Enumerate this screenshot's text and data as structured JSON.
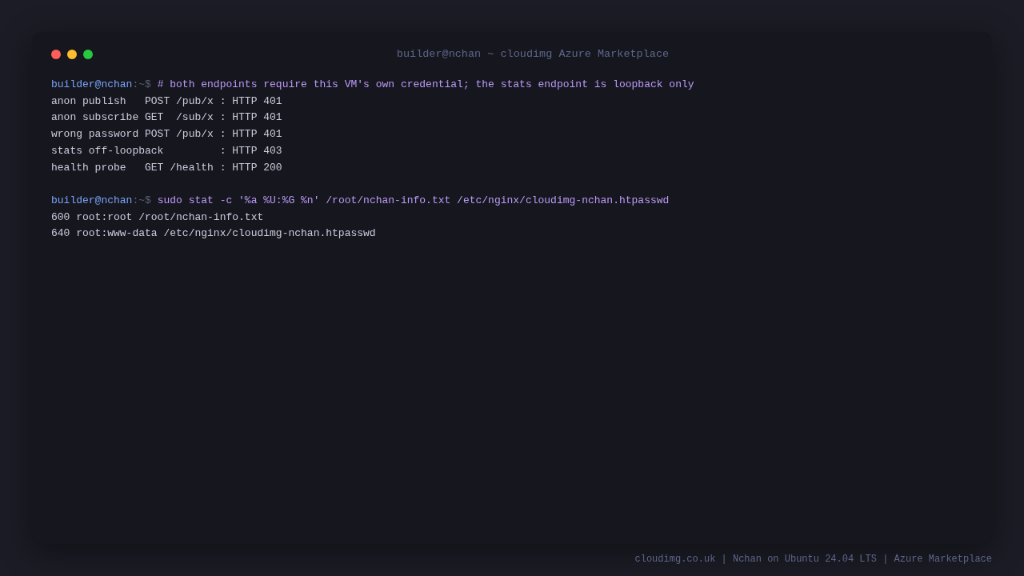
{
  "window": {
    "title": "builder@nchan ~ cloudimg Azure Marketplace"
  },
  "blocks": [
    {
      "prompt": {
        "user": "builder@nchan",
        "path": ":~$",
        "command": "# both endpoints require this VM's own credential; the stats endpoint is loopback only"
      },
      "output": [
        "anon publish   POST /pub/x : HTTP 401",
        "anon subscribe GET  /sub/x : HTTP 401",
        "wrong password POST /pub/x : HTTP 401",
        "stats off-loopback         : HTTP 403",
        "health probe   GET /health : HTTP 200"
      ]
    },
    {
      "prompt": {
        "user": "builder@nchan",
        "path": ":~$",
        "command": "sudo stat -c '%a %U:%G %n' /root/nchan-info.txt /etc/nginx/cloudimg-nchan.htpasswd"
      },
      "output": [
        "600 root:root /root/nchan-info.txt",
        "640 root:www-data /etc/nginx/cloudimg-nchan.htpasswd"
      ]
    }
  ],
  "footer": "cloudimg.co.uk | Nchan on Ubuntu 24.04 LTS | Azure Marketplace"
}
